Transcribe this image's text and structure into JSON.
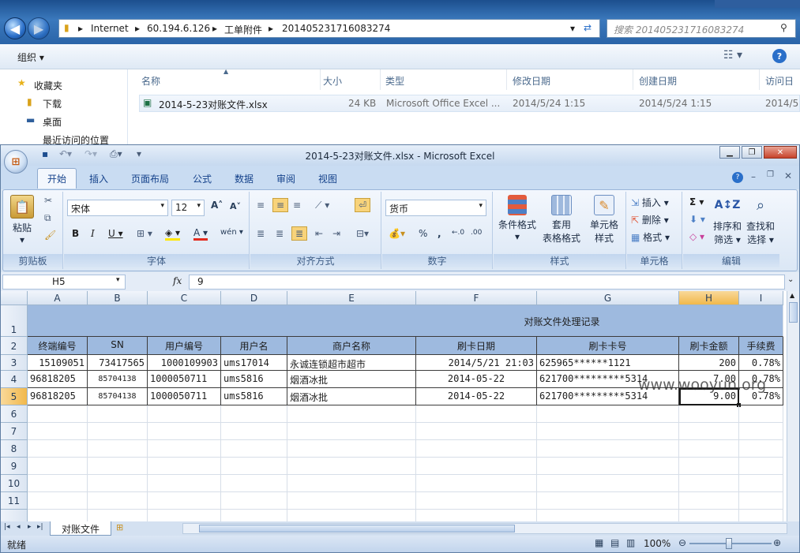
{
  "explorer": {
    "breadcrumb": [
      "Internet",
      "60.194.6.126",
      "工单附件",
      "201405231716083274"
    ],
    "search_placeholder": "搜索 201405231716083274",
    "organize": "组织 ▾",
    "nav": [
      "收藏夹",
      "下载",
      "桌面",
      "最近访问的位置"
    ],
    "columns": [
      "名称",
      "大小",
      "类型",
      "修改日期",
      "创建日期",
      "访问日"
    ],
    "file": {
      "name": "2014-5-23对账文件.xlsx",
      "size": "24 KB",
      "type": "Microsoft Office Excel ...",
      "modified": "2014/5/24 1:15",
      "created": "2014/5/24 1:15",
      "accessed": "2014/5"
    }
  },
  "excel": {
    "title": "2014-5-23对账文件.xlsx - Microsoft Excel",
    "tabs": [
      "开始",
      "插入",
      "页面布局",
      "公式",
      "数据",
      "审阅",
      "视图"
    ],
    "ribbon": {
      "paste": "粘贴",
      "clipboard": "剪贴板",
      "font_name": "宋体",
      "font_size": "12",
      "font_group": "字体",
      "align_group": "对齐方式",
      "number_format": "货币",
      "number_group": "数字",
      "cond_format": "条件格式",
      "table_format1": "套用",
      "table_format2": "表格格式",
      "cell_style1": "单元格",
      "cell_style2": "样式",
      "style_group": "样式",
      "insert": "插入",
      "delete": "删除",
      "format": "格式",
      "cells_group": "单元格",
      "sort1": "排序和",
      "sort2": "筛选",
      "find1": "查找和",
      "find2": "选择",
      "edit_group": "编辑"
    },
    "name_box": "H5",
    "formula_value": "9",
    "columns": [
      "A",
      "B",
      "C",
      "D",
      "E",
      "F",
      "G",
      "H",
      "I"
    ],
    "rows": [
      "1",
      "2",
      "3",
      "4",
      "5",
      "6",
      "7",
      "8",
      "9",
      "10",
      "11"
    ],
    "sheet_title": "对账文件处理记录",
    "headers": [
      "终端编号",
      "SN",
      "用户编号",
      "用户名",
      "商户名称",
      "刷卡日期",
      "刷卡卡号",
      "刷卡金额",
      "手续费"
    ],
    "data": [
      [
        "15109051",
        "73417565",
        "1000109903",
        "ums17014",
        "永诚连锁超市超市",
        "2014/5/21 21:03",
        "625965******1121",
        "200",
        "0.78%"
      ],
      [
        "96818205",
        "85704138",
        "1000050711",
        "ums5816",
        "烟酒冰批",
        "2014-05-22",
        "621700*********5314",
        "7.00",
        "0.78%"
      ],
      [
        "96818205",
        "85704138",
        "1000050711",
        "ums5816",
        "烟酒冰批",
        "2014-05-22",
        "621700*********5314",
        "9.00",
        "0.78%"
      ]
    ],
    "sheet_tab": "对账文件",
    "status": "就绪",
    "zoom": "100%"
  },
  "watermark": "www.wooyun.org"
}
